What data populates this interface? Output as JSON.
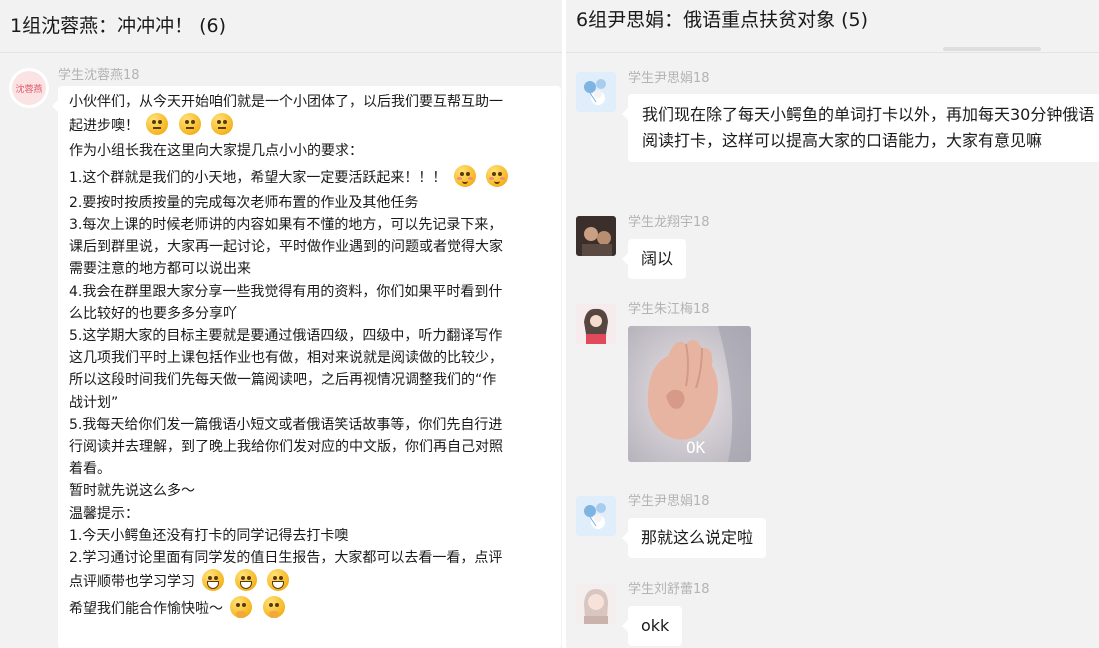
{
  "left_chat": {
    "title": "1组沈蓉燕：冲冲冲！ (6)",
    "message": {
      "sender": "学生沈蓉燕18",
      "avatar_text": "沈蓉燕",
      "lines": [
        "小伙伴们，从今天开始咱们就是一个小团体了，以后我们要互帮互助一",
        "起进步噢！",
        "作为小组长我在这里向大家提几点小小的要求：",
        "1.这个群就是我们的小天地，希望大家一定要活跃起来！！！",
        "2.要按时按质按量的完成每次老师布置的作业及其他任务",
        "3.每次上课的时候老师讲的内容如果有不懂的地方，可以先记录下来，",
        "课后到群里说，大家再一起讨论，平时做作业遇到的问题或者觉得大家",
        "需要注意的地方都可以说出来",
        "4.我会在群里跟大家分享一些我觉得有用的资料，你们如果平时看到什",
        "么比较好的也要多多分享吖",
        "5.这学期大家的目标主要就是要通过俄语四级，四级中，听力翻译写作",
        "这几项我们平时上课包括作业也有做，相对来说就是阅读做的比较少，",
        "所以这段时间我们先每天做一篇阅读吧，之后再视情况调整我们的“作",
        "战计划”",
        "5.我每天给你们发一篇俄语小短文或者俄语笑话故事等，你们先自行进",
        "行阅读并去理解，到了晚上我给你们发对应的中文版，你们再自己对照",
        "着看。",
        "暂时就先说这么多～",
        "温馨提示：",
        "1.今天小鳄鱼还没有打卡的同学记得去打卡噢",
        "2.学习通讨论里面有同学发的值日生报告，大家都可以去看一看，点评",
        "点评顺带也学习学习",
        "希望我们能合作愉快啦～"
      ]
    }
  },
  "right_chat": {
    "title": "6组尹思娟：俄语重点扶贫对象 (5)",
    "messages": [
      {
        "sender": "学生尹思娟18",
        "text": "我们现在除了每天小鳄鱼的单词打卡以外，再加每天30分钟俄语阅读打卡，这样可以提高大家的口语能力，大家有意见嘛"
      },
      {
        "sender": "学生龙翔宇18",
        "text": "阔以"
      },
      {
        "sender": "学生朱江梅18",
        "image_caption": "OK"
      },
      {
        "sender": "学生尹思娟18",
        "text": "那就这么说定啦"
      },
      {
        "sender": "学生刘舒蕾18",
        "text": "okk"
      }
    ]
  },
  "emoji_names": [
    "thinking-face-emoji",
    "blushing-face-emoji",
    "grinning-face-emoji",
    "hand-over-mouth-emoji"
  ],
  "colors": {
    "background": "#f2f2f2",
    "bubble": "#ffffff",
    "sender_text": "#b3b3b3",
    "divider": "#ffffff"
  }
}
